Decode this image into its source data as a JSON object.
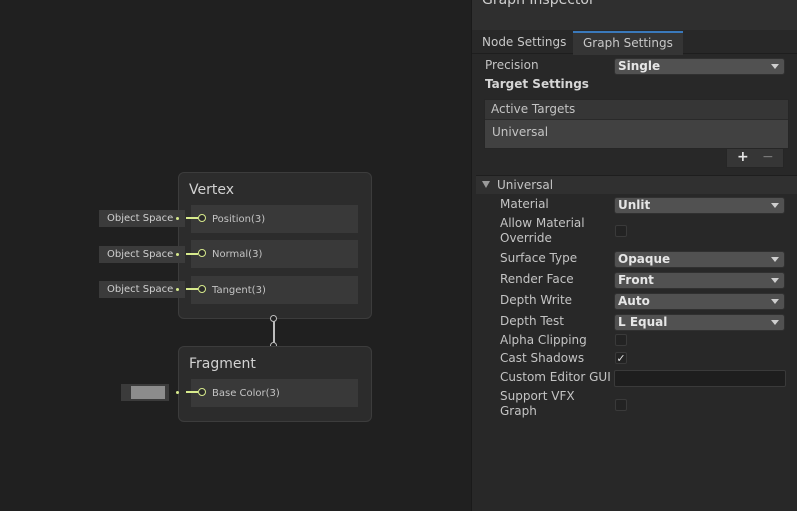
{
  "graph": {
    "vertex": {
      "title": "Vertex",
      "slots": [
        {
          "label": "Position(3)",
          "space": "Object Space"
        },
        {
          "label": "Normal(3)",
          "space": "Object Space"
        },
        {
          "label": "Tangent(3)",
          "space": "Object Space"
        }
      ]
    },
    "fragment": {
      "title": "Fragment",
      "slots": [
        {
          "label": "Base Color(3)",
          "swatch_color": "#8c8c8c"
        }
      ]
    },
    "wire_color": "#d7ea8c"
  },
  "inspector": {
    "title": "Graph Inspector",
    "tabs": [
      "Node Settings",
      "Graph Settings"
    ],
    "active_tab": "Graph Settings",
    "precision": {
      "label": "Precision",
      "value": "Single"
    },
    "target_settings_label": "Target Settings",
    "active_targets": {
      "header": "Active Targets",
      "items": [
        "Universal"
      ],
      "add_symbol": "+",
      "remove_symbol": "−"
    },
    "universal": {
      "header": "Universal",
      "fields": {
        "material": {
          "label": "Material",
          "value": "Unlit"
        },
        "allow_override": {
          "label": "Allow Material Override",
          "checked": false
        },
        "surface_type": {
          "label": "Surface Type",
          "value": "Opaque"
        },
        "render_face": {
          "label": "Render Face",
          "value": "Front"
        },
        "depth_write": {
          "label": "Depth Write",
          "value": "Auto"
        },
        "depth_test": {
          "label": "Depth Test",
          "value": "L Equal"
        },
        "alpha_clipping": {
          "label": "Alpha Clipping",
          "checked": false
        },
        "cast_shadows": {
          "label": "Cast Shadows",
          "checked": true
        },
        "custom_editor_gui": {
          "label": "Custom Editor GUI",
          "value": ""
        },
        "support_vfx": {
          "label": "Support VFX Graph",
          "checked": false
        }
      }
    }
  }
}
